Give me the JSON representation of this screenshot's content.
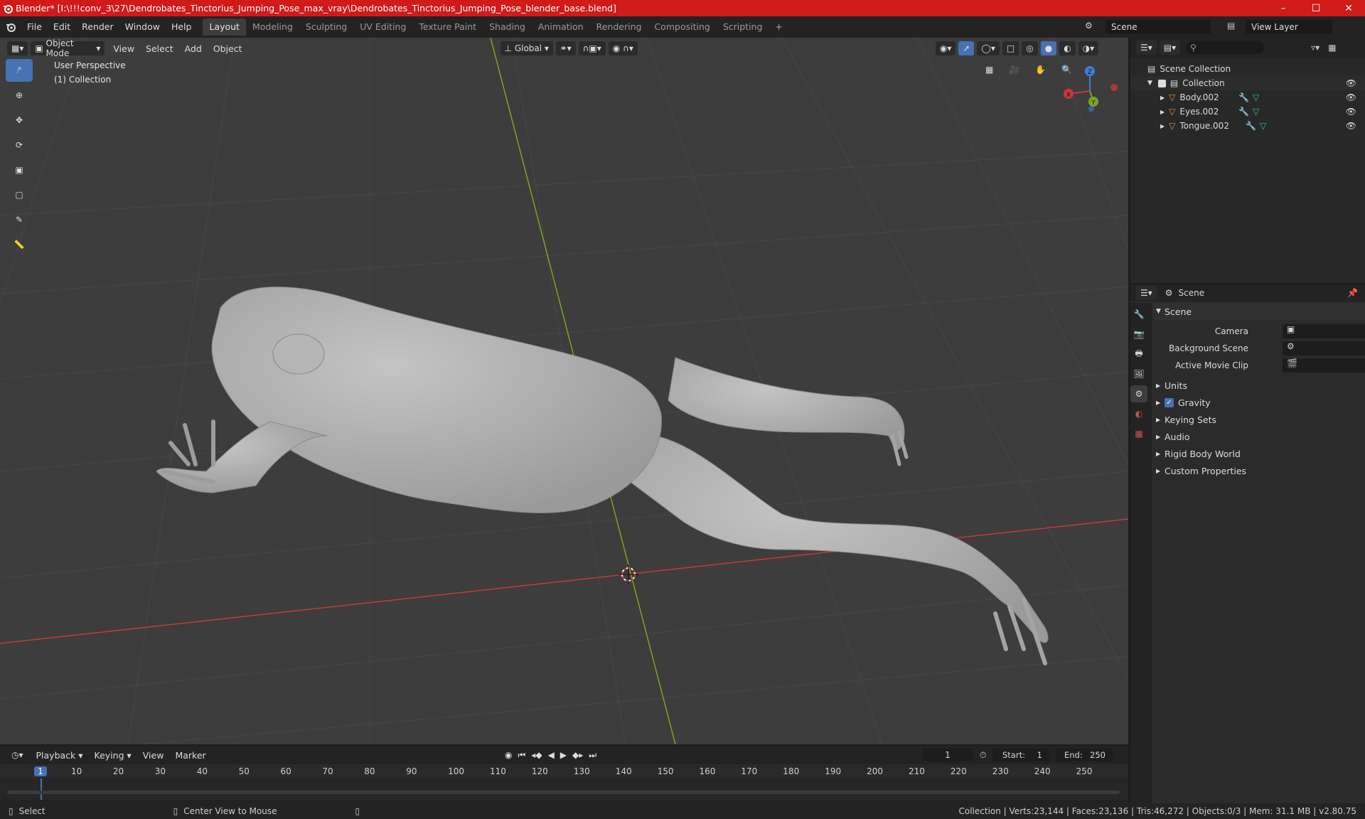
{
  "titlebar": {
    "title": "Blender* [I:\\!!!conv_3\\27\\Dendrobates_Tinctorius_Jumping_Pose_max_vray\\Dendrobates_Tinctorius_Jumping_Pose_blender_base.blend]",
    "minimize": "–",
    "maximize": "☐",
    "close": "✕"
  },
  "menu": {
    "file": "File",
    "edit": "Edit",
    "render": "Render",
    "window": "Window",
    "help": "Help"
  },
  "workspaces": [
    "Layout",
    "Modeling",
    "Sculpting",
    "UV Editing",
    "Texture Paint",
    "Shading",
    "Animation",
    "Rendering",
    "Compositing",
    "Scripting"
  ],
  "scene": {
    "name": "Scene",
    "view_layer": "View Layer"
  },
  "viewport": {
    "mode": "Object Mode",
    "menus": [
      "View",
      "Select",
      "Add",
      "Object"
    ],
    "orientation": "Global",
    "perspective_label": "User Perspective",
    "collection_label": "(1) Collection",
    "gizmo": {
      "x": "X",
      "y": "Y",
      "z": "Z"
    }
  },
  "outliner": {
    "root": "Scene Collection",
    "collection": "Collection",
    "objects": [
      "Body.002",
      "Eyes.002",
      "Tongue.002"
    ]
  },
  "properties": {
    "header": "Scene",
    "panel_scene": "Scene",
    "camera_label": "Camera",
    "background_scene_label": "Background Scene",
    "active_movie_clip_label": "Active Movie Clip",
    "panels": [
      "Units",
      "Gravity",
      "Keying Sets",
      "Audio",
      "Rigid Body World",
      "Custom Properties"
    ]
  },
  "timeline": {
    "playback": "Playback",
    "keying": "Keying",
    "view": "View",
    "marker": "Marker",
    "current_frame": "1",
    "start_label": "Start:",
    "start": "1",
    "end_label": "End:",
    "end": "250",
    "ticks": [
      "1",
      "10",
      "20",
      "30",
      "40",
      "50",
      "60",
      "70",
      "80",
      "90",
      "100",
      "110",
      "120",
      "130",
      "140",
      "150",
      "160",
      "170",
      "180",
      "190",
      "200",
      "210",
      "220",
      "230",
      "240",
      "250"
    ]
  },
  "status": {
    "select": "Select",
    "center_view": "Center View to Mouse",
    "stats": "Collection | Verts:23,144 | Faces:23,136 | Tris:46,272 | Objects:0/3 | Mem: 31.1 MB | v2.80.75"
  },
  "colors": {
    "title_bg": "#d11a1a",
    "accent": "#4772b3",
    "viewport_bg": "#3d3d3d",
    "x_axis": "#c8373d",
    "y_axis": "#7aa61f"
  }
}
